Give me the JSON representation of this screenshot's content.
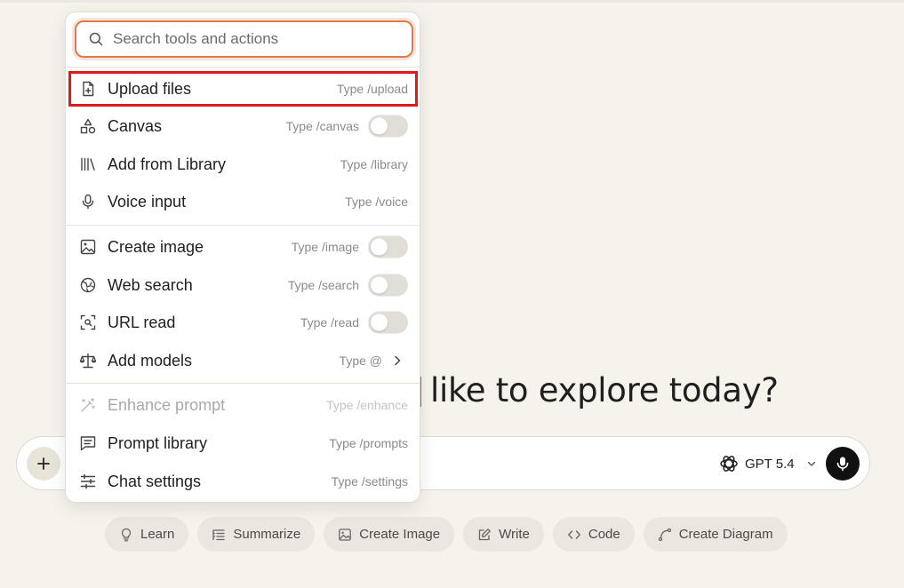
{
  "colors": {
    "background": "#f6f3ec",
    "accent_orange": "#e07a4e",
    "highlight_red": "#e0191d",
    "mic_button": "#111111"
  },
  "headline": {
    "text": "like to explore today?"
  },
  "composer": {
    "plus_icon": "plus-icon",
    "model_label": "GPT 5.4",
    "model_icon": "openai-logo-icon",
    "mic_icon": "microphone-icon"
  },
  "chips": [
    {
      "label": "Learn",
      "icon": "lightbulb-icon"
    },
    {
      "label": "Summarize",
      "icon": "list-indent-icon"
    },
    {
      "label": "Create Image",
      "icon": "image-icon"
    },
    {
      "label": "Write",
      "icon": "pencil-square-icon"
    },
    {
      "label": "Code",
      "icon": "code-brackets-icon"
    },
    {
      "label": "Create Diagram",
      "icon": "curve-icon"
    }
  ],
  "menu": {
    "search": {
      "placeholder": "Search tools and actions",
      "value": ""
    },
    "items": [
      {
        "label": "Upload files",
        "hint": "Type /upload",
        "icon": "file-plus-icon",
        "highlighted": true
      },
      {
        "label": "Canvas",
        "hint": "Type /canvas",
        "icon": "shapes-icon",
        "toggle": false
      },
      {
        "label": "Add from Library",
        "hint": "Type /library",
        "icon": "library-icon"
      },
      {
        "label": "Voice input",
        "hint": "Type /voice",
        "icon": "microphone-icon"
      },
      {
        "label": "Create image",
        "hint": "Type /image",
        "icon": "image-icon",
        "toggle": false
      },
      {
        "label": "Web search",
        "hint": "Type /search",
        "icon": "globe-icon",
        "toggle": false
      },
      {
        "label": "URL read",
        "hint": "Type /read",
        "icon": "scan-link-icon",
        "toggle": false
      },
      {
        "label": "Add models",
        "hint": "Type @",
        "icon": "scale-icon",
        "submenu": true
      },
      {
        "label": "Enhance prompt",
        "hint": "Type /enhance",
        "icon": "magic-wand-icon",
        "disabled": true
      },
      {
        "label": "Prompt library",
        "hint": "Type /prompts",
        "icon": "message-lines-icon"
      },
      {
        "label": "Chat settings",
        "hint": "Type /settings",
        "icon": "sliders-icon"
      }
    ]
  }
}
